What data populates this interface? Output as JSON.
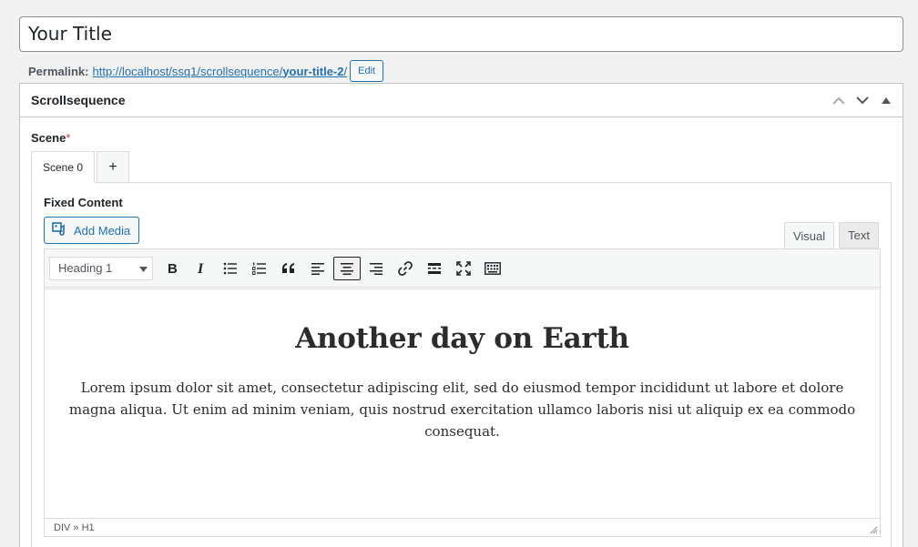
{
  "title_input": {
    "value": "Your Title"
  },
  "permalink": {
    "label": "Permalink:",
    "url_base": "http://localhost/ssq1/scrollsequence/",
    "slug": "your-title-2",
    "slash": "/",
    "edit_label": "Edit"
  },
  "postbox": {
    "title": "Scrollsequence",
    "scene_label": "Scene",
    "required_mark": "*",
    "tabs": [
      {
        "label": "Scene 0"
      },
      {
        "label": "+"
      }
    ],
    "fixed_content_label": "Fixed Content",
    "add_media_label": "Add Media",
    "mode_tabs": [
      {
        "label": "Visual"
      },
      {
        "label": "Text"
      }
    ],
    "format_select": {
      "value": "Heading 1"
    },
    "toolbar_icons": [
      "bold-icon",
      "italic-icon",
      "bullet-list-icon",
      "numbered-list-icon",
      "blockquote-icon",
      "align-left-icon",
      "align-center-icon",
      "align-right-icon",
      "link-icon",
      "read-more-icon",
      "fullscreen-icon",
      "toolbar-toggle-icon"
    ],
    "content": {
      "heading": "Another day on Earth",
      "paragraph": "Lorem ipsum dolor sit amet, consectetur adipiscing elit, sed do eiusmod tempor incididunt ut labore et dolore magna aliqua. Ut enim ad minim veniam, quis nostrud exercitation ullamco laboris nisi ut aliquip ex ea commodo consequat."
    },
    "status_path": "DIV » H1"
  },
  "colors": {
    "accent": "#2271b1",
    "required": "#d63638",
    "border": "#c3c4c7"
  }
}
